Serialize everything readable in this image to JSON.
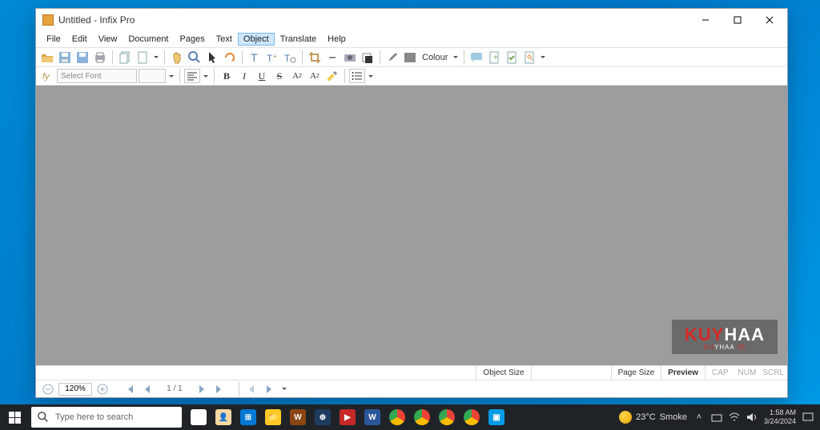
{
  "window": {
    "title": "Untitled - Infix Pro"
  },
  "menu": {
    "items": [
      "File",
      "Edit",
      "View",
      "Document",
      "Pages",
      "Text",
      "Object",
      "Translate",
      "Help"
    ],
    "active_index": 6
  },
  "toolbar": {
    "colour_label": "Colour"
  },
  "format": {
    "font_placeholder": "Select Font",
    "bold": "B",
    "italic": "I",
    "underline": "U",
    "strike": "S",
    "super": "A",
    "sub": "A"
  },
  "status": {
    "object_size": "Object Size",
    "page_size": "Page Size",
    "preview": "Preview",
    "caps": "CAP",
    "num": "NUM",
    "scrl": "SCRL"
  },
  "nav": {
    "zoom": "120%",
    "page": "1 / 1"
  },
  "watermark": {
    "line1_a": "KUY",
    "line1_b": "HAA",
    "line2_a": "KU",
    "line2_b": "YHAA",
    "line2_c": ".ID"
  },
  "taskbar": {
    "search_placeholder": "Type here to search",
    "weather_temp": "23°C",
    "weather_cond": "Smoke",
    "time": "1:58 AM",
    "date": "3/24/2024"
  }
}
